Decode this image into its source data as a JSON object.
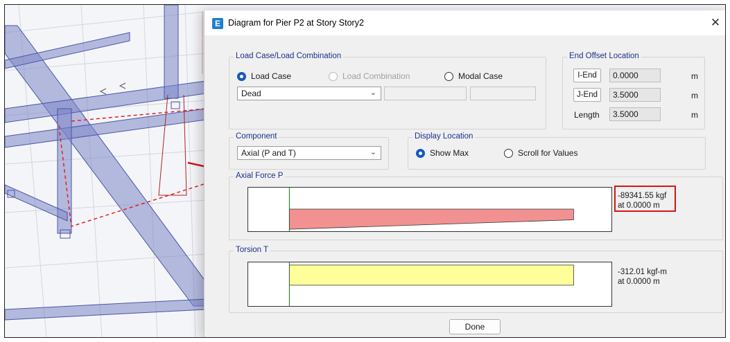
{
  "dialog": {
    "title": "Diagram for Pier P2 at Story Story2",
    "app_icon_letter": "E",
    "close_glyph": "✕"
  },
  "load_case": {
    "group_title": "Load Case/Load Combination",
    "options": [
      "Load Case",
      "Load Combination",
      "Modal Case"
    ],
    "selected_option": "Load Case",
    "case_select_value": "Dead"
  },
  "end_offset": {
    "group_title": "End Offset Location",
    "rows": [
      {
        "button": "I-End",
        "value": "0.0000",
        "unit": "m"
      },
      {
        "button": "J-End",
        "value": "3.5000",
        "unit": "m"
      },
      {
        "label": "Length",
        "value": "3.5000",
        "unit": "m"
      }
    ]
  },
  "component": {
    "group_title": "Component",
    "select_value": "Axial (P and T)"
  },
  "display_location": {
    "group_title": "Display Location",
    "options": [
      "Show Max",
      "Scroll for Values"
    ],
    "selected_option": "Show Max"
  },
  "axial": {
    "group_title": "Axial Force P",
    "value_text": "-89341.55 kgf",
    "location_text": "at 0.0000 m",
    "diagram_color": "#f29191",
    "highlighted": true
  },
  "torsion": {
    "group_title": "Torsion T",
    "value_text": "-312.01 kgf-m",
    "location_text": "at 0.0000 m",
    "diagram_color": "#ffff99"
  },
  "done_label": "Done",
  "colors": {
    "accent": "#1557c0",
    "group_title": "#1d2f8a",
    "annotation_red": "#d31717",
    "frame_member": "#5a66b0"
  }
}
